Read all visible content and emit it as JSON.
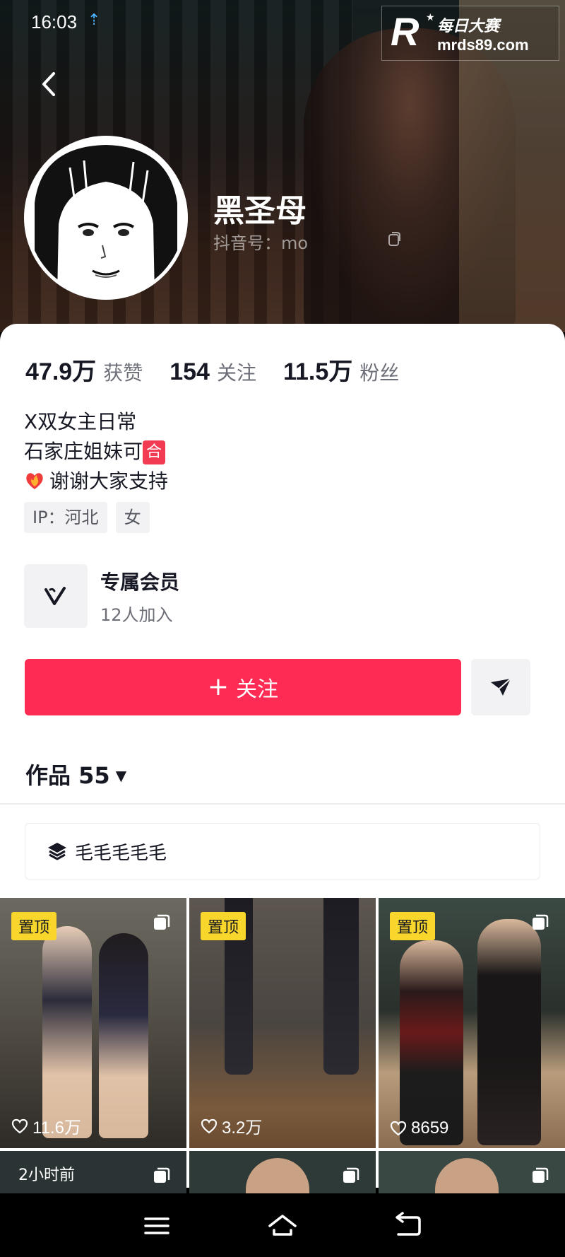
{
  "status_bar": {
    "time": "16:03",
    "upload_glyph": "⇡"
  },
  "watermark": {
    "logo": "R",
    "star": "★",
    "cn": "每日大赛",
    "url": "mrds89.com"
  },
  "profile": {
    "nickname": "黑圣母",
    "douyin_id": "抖音号：mo"
  },
  "stats": [
    {
      "value": "47.9万",
      "label": "获赞"
    },
    {
      "value": "154",
      "label": "关注"
    },
    {
      "value": "11.5万",
      "label": "粉丝"
    }
  ],
  "bio": {
    "line1": "X双女主日常",
    "line2": "石家庄姐妹可",
    "line2_badge": "合",
    "line3": "谢谢大家支持"
  },
  "tags": [
    "IP：河北",
    "女"
  ],
  "member": {
    "title": "专属会员",
    "subtitle": "12人加入"
  },
  "actions": {
    "follow_label": "关注",
    "follow_plus": "+"
  },
  "works": {
    "label": "作品 55",
    "caret": "▼"
  },
  "collection": {
    "label": "毛毛毛毛毛"
  },
  "grid": [
    {
      "pin": "置顶",
      "likes": "11.6万"
    },
    {
      "pin": "置顶",
      "likes": "3.2万"
    },
    {
      "pin": "置顶",
      "likes": "8659"
    },
    {
      "time": "2小时前"
    }
  ],
  "colors": {
    "accent": "#fe2c55",
    "pin_bg": "#f8d62b",
    "text": "#161823",
    "muted": "#6d6f78"
  }
}
